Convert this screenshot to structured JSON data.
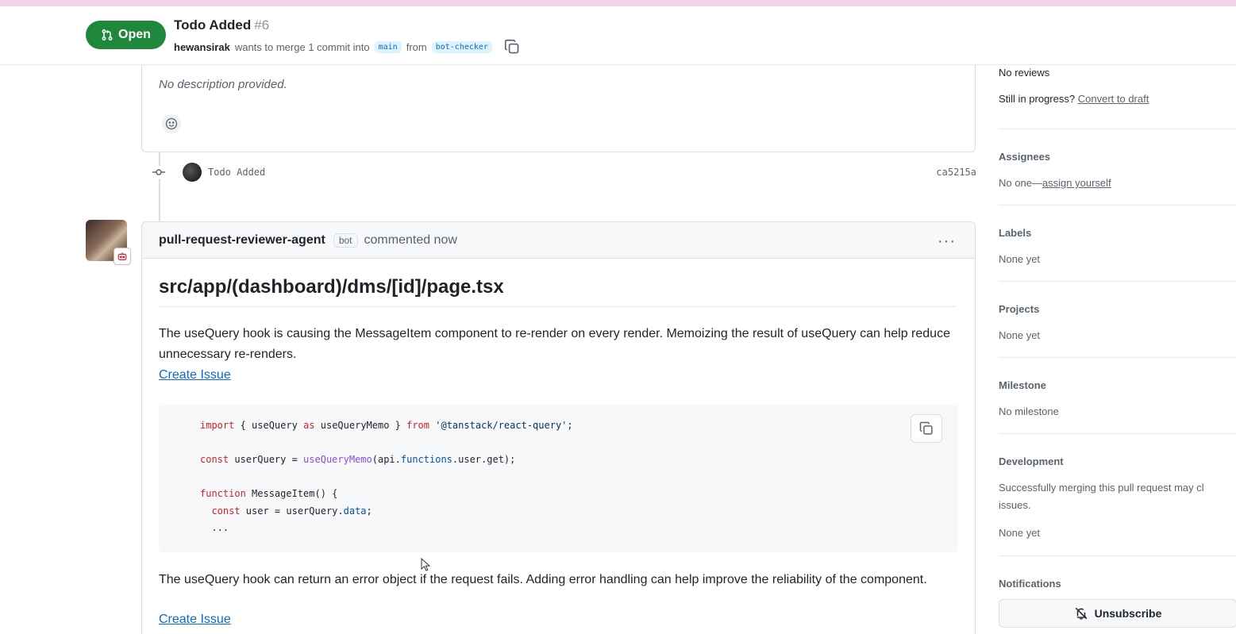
{
  "header": {
    "state_label": "Open",
    "title": "Todo Added",
    "number": "#6",
    "author": "hewansirak",
    "merge_text": "wants to merge 1 commit into",
    "base_branch": "main",
    "from_text": "from",
    "head_branch": "bot-checker"
  },
  "description": {
    "text": "No description provided."
  },
  "commit": {
    "message": "Todo Added",
    "sha": "ca5215a"
  },
  "comment": {
    "author": "pull-request-reviewer-agent",
    "bot_label": "bot",
    "time": "commented now",
    "more": "···",
    "file_heading": "src/app/(dashboard)/dms/[id]/page.tsx",
    "para1": "The useQuery hook is causing the MessageItem component to re-render on every render. Memoizing the result of useQuery can help reduce unnecessary re-renders.",
    "create_issue_1": "Create Issue",
    "code": {
      "l1_kw": "import",
      "l1_a": " { useQuery ",
      "l1_as": "as",
      "l1_b": " useQueryMemo } ",
      "l1_from": "from",
      "l1_str": " '@tanstack/react-query'",
      "l1_end": ";",
      "l2_kw": "const",
      "l2_a": " userQuery = ",
      "l2_fn": "useQueryMemo",
      "l2_b": "(api.",
      "l2_prop": "functions",
      "l2_c": ".user.get);",
      "l3_kw": "function",
      "l3_a": " MessageItem() {",
      "l4_kw": "  const",
      "l4_a": " user = userQuery.",
      "l4_prop": "data",
      "l4_end": ";",
      "l5": "  ..."
    },
    "para2": "The useQuery hook can return an error object if the request fails. Adding error handling can help improve the reliability of the component.",
    "create_issue_2": "Create Issue"
  },
  "sidebar": {
    "reviews_value": "No reviews",
    "in_progress_text": "Still in progress?",
    "convert_link": "Convert to draft",
    "assignees_heading": "Assignees",
    "assignees_value": "No one—",
    "assign_link": "assign yourself",
    "labels_heading": "Labels",
    "labels_value": "None yet",
    "projects_heading": "Projects",
    "projects_value": "None yet",
    "milestone_heading": "Milestone",
    "milestone_value": "No milestone",
    "development_heading": "Development",
    "development_text_1": "Successfully merging this pull request may cl",
    "development_text_2": "issues.",
    "development_value": "None yet",
    "notifications_heading": "Notifications",
    "unsubscribe_label": "Unsubscribe"
  },
  "colors": {
    "open_green": "#1f883d",
    "link_blue": "#0969da",
    "top_strip": "#f6d3e6"
  }
}
